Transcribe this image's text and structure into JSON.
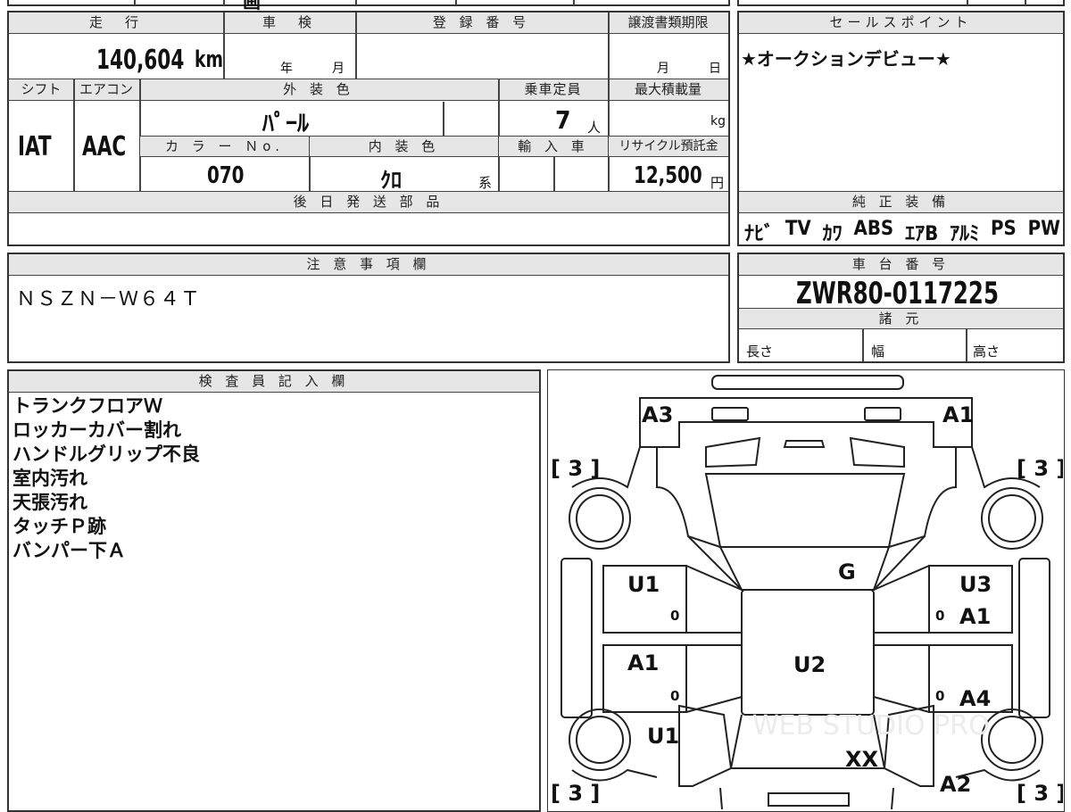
{
  "top_fragments": {
    "partial": "画"
  },
  "main": {
    "headers": {
      "mileage": "走　行",
      "shaken": "車　検",
      "registration": "登 録 番 号",
      "transfer_deadline": "譲渡書類期限",
      "shift": "シフト",
      "aircon": "エアコン",
      "exterior_color": "外 装 色",
      "capacity": "乗車定員",
      "max_load": "最大積載量",
      "color_no": "カ ラ ー Ｎo.",
      "interior_color": "内 装 色",
      "import": "輸 入 車",
      "recycle": "リサイクル預託金"
    },
    "values": {
      "mileage": "140,604",
      "mileage_unit": "km",
      "year_label": "年",
      "month_label": "月",
      "deadline_month": "月",
      "deadline_day": "日",
      "shift": "IAT",
      "aircon": "AAC",
      "exterior_color": "ﾊﾟｰﾙ",
      "capacity": "7",
      "capacity_unit": "人",
      "max_load_unit": "kg",
      "color_no": "070",
      "interior_color": "ｸﾛ",
      "interior_suffix": "系",
      "recycle": "12,500",
      "recycle_unit": "円"
    },
    "later_parts_header": "後 日 発 送 部 品"
  },
  "sales_point": {
    "header": "セールスポイント",
    "text": "★オークションデビュー★"
  },
  "equipment": {
    "header": "純 正 装 備",
    "items": [
      "ﾅﾋﾞ",
      "TV",
      "ｶﾜ",
      "ABS",
      "ｴｱB",
      "ｱﾙﾐ",
      "PS",
      "PW"
    ]
  },
  "notes": {
    "header": "注 意 事 項 欄",
    "text": "ＮＳＺＮ－Ｗ６４Ｔ"
  },
  "chassis": {
    "header": "車 台 番 号",
    "number": "ZWR80-0117225",
    "specs_header": "諸 元",
    "length": "長さ",
    "width": "幅",
    "height": "高さ"
  },
  "inspector": {
    "header": "検 査 員 記 入 欄",
    "lines": [
      "トランクフロアＷ",
      "ロッカーカバー割れ",
      "ハンドルグリップ不良",
      "室内汚れ",
      "天張汚れ",
      "タッチＰ跡",
      "バンパー下Ａ"
    ]
  },
  "diagram": {
    "marks": {
      "a3_top": "A3",
      "a1_top": "A1",
      "tire_tl": "[ 3 ]",
      "tire_tr": "[ 3 ]",
      "tire_bl": "[ 3 ]",
      "tire_br": "[ 3 ]",
      "g": "G",
      "u1_left": "U1",
      "u3_right": "U3",
      "a1_right": "A1",
      "a1_left": "A1",
      "u2_center": "U2",
      "a4_right": "A4",
      "u1_lower": "U1",
      "xx": "XX",
      "a2": "A2",
      "zero1": "0",
      "zero2": "0",
      "zero3": "0",
      "zero4": "0"
    },
    "watermark": "WEB STUDIO PRO"
  }
}
